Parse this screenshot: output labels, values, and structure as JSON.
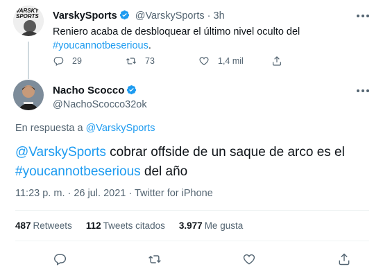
{
  "parent_tweet": {
    "name": "VarskySports",
    "handle": "@VarskySports",
    "separator": "·",
    "time": "3h",
    "avatar_text_line1": "VARSKY",
    "avatar_text_line2": "SPORTS",
    "text_line1": "Reniero acaba de desbloquear el último nivel oculto del",
    "hashtag": "#youcannotbeserious",
    "hashtag_suffix": ".",
    "replies": "29",
    "retweets": "73",
    "likes": "1,4 mil"
  },
  "main_tweet": {
    "name": "Nacho Scocco",
    "handle": "@NachoScocco32ok",
    "reply_prefix": "En respuesta a",
    "reply_to": "@VarskySports",
    "mention": "@VarskySports",
    "text_middle": " cobrar offside de un saque de arco es el ",
    "hashtag": "#youcannotbeserious",
    "text_end": " del año",
    "timestamp": "11:23 p. m. · 26 jul. 2021 · ",
    "source": "Twitter for iPhone",
    "stats": {
      "retweets_count": "487",
      "retweets_label": "Retweets",
      "quotes_count": "112",
      "quotes_label": "Tweets citados",
      "likes_count": "3.977",
      "likes_label": "Me gusta"
    }
  },
  "colors": {
    "accent": "#1d9bf0",
    "text": "#0f1419",
    "secondary": "#536471",
    "divider": "#eff3f4"
  }
}
